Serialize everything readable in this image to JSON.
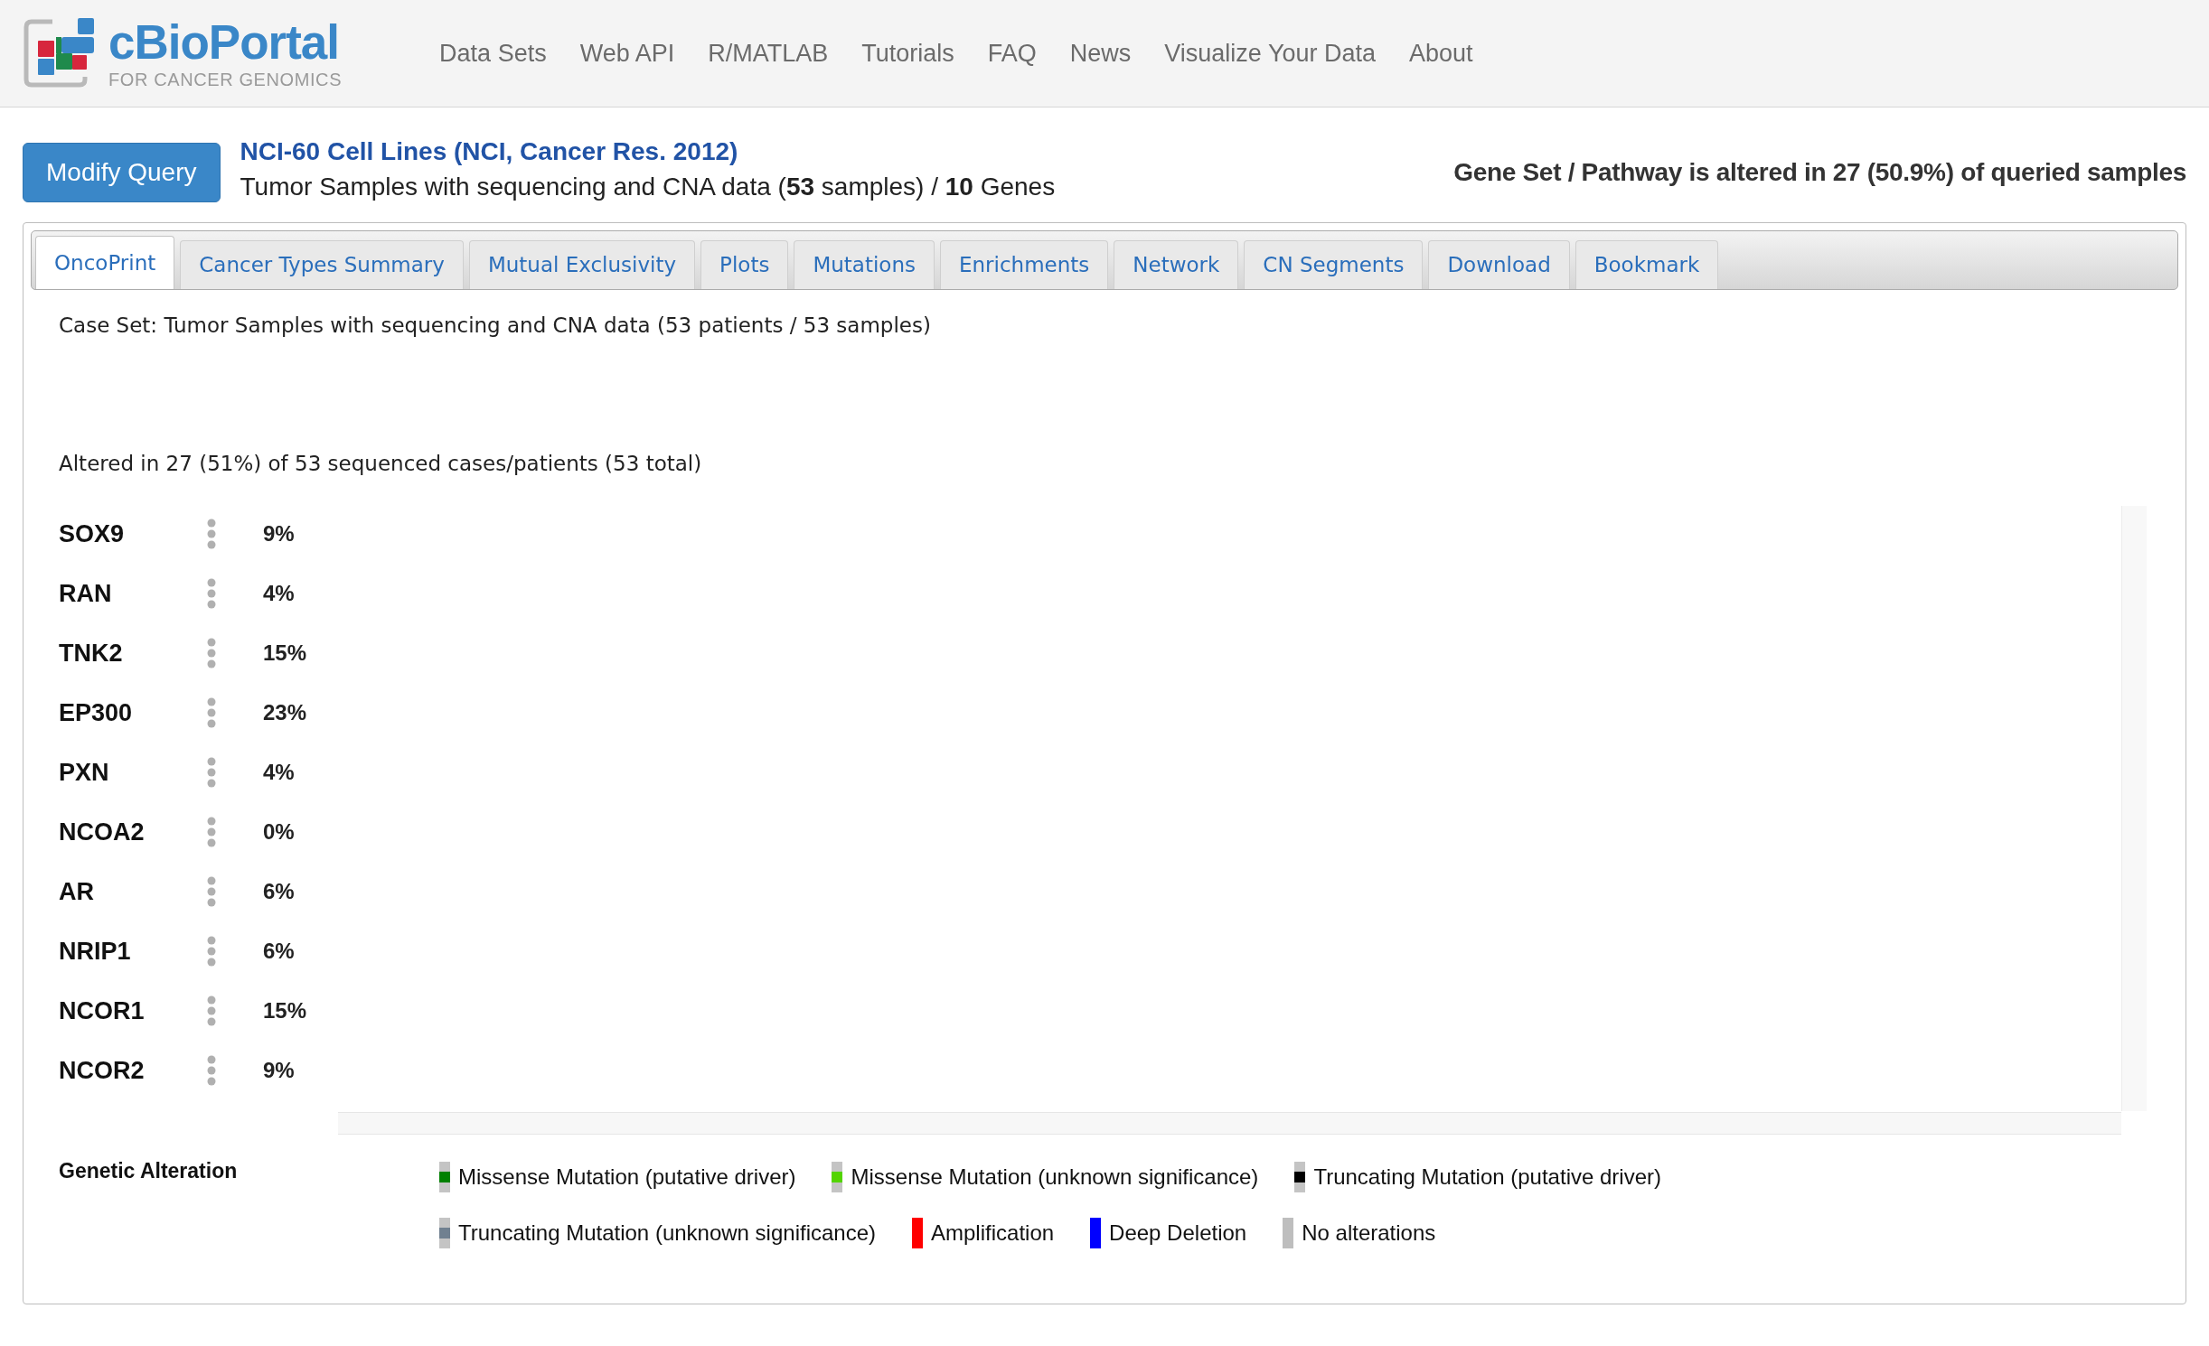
{
  "header": {
    "logo": {
      "title": "cBioPortal",
      "tagline": "FOR CANCER GENOMICS"
    },
    "nav": [
      "Data Sets",
      "Web API",
      "R/MATLAB",
      "Tutorials",
      "FAQ",
      "News",
      "Visualize Your Data",
      "About"
    ]
  },
  "query": {
    "button": "Modify Query",
    "study_title": "NCI-60 Cell Lines (NCI, Cancer Res. 2012)",
    "subtitle": "Tumor Samples with sequencing and CNA data (**53** samples) / **10** Genes",
    "summary": "Gene Set / Pathway is altered in 27 (50.9%) of queried samples"
  },
  "tabs": [
    {
      "label": "OncoPrint",
      "selected": true
    },
    {
      "label": "Cancer Types Summary",
      "selected": false
    },
    {
      "label": "Mutual Exclusivity",
      "selected": false
    },
    {
      "label": "Plots",
      "selected": false
    },
    {
      "label": "Mutations",
      "selected": false
    },
    {
      "label": "Enrichments",
      "selected": false
    },
    {
      "label": "Network",
      "selected": false
    },
    {
      "label": "CN Segments",
      "selected": false
    },
    {
      "label": "Download",
      "selected": false
    },
    {
      "label": "Bookmark",
      "selected": false
    }
  ],
  "oncoprint": {
    "case_set": "Case Set: Tumor Samples with sequencing and CNA data (53 patients / 53 samples)",
    "altered": "Altered in 27 (51%) of 53 sequenced cases/patients (53 total)",
    "genes": [
      {
        "name": "SOX9",
        "percent": "9%"
      },
      {
        "name": "RAN",
        "percent": "4%"
      },
      {
        "name": "TNK2",
        "percent": "15%"
      },
      {
        "name": "EP300",
        "percent": "23%"
      },
      {
        "name": "PXN",
        "percent": "4%"
      },
      {
        "name": "NCOA2",
        "percent": "0%"
      },
      {
        "name": "AR",
        "percent": "6%"
      },
      {
        "name": "NRIP1",
        "percent": "6%"
      },
      {
        "name": "NCOR1",
        "percent": "15%"
      },
      {
        "name": "NCOR2",
        "percent": "9%"
      }
    ],
    "legend": {
      "title": "Genetic Alteration",
      "items": [
        {
          "label": "Missense Mutation (putative driver)",
          "kind": "mutation",
          "color": "#008000"
        },
        {
          "label": "Missense Mutation (unknown significance)",
          "kind": "mutation",
          "color": "#53d400"
        },
        {
          "label": "Truncating Mutation (putative driver)",
          "kind": "mutation",
          "color": "#000000"
        },
        {
          "label": "Truncating Mutation (unknown significance)",
          "kind": "mutation",
          "color": "#708090"
        },
        {
          "label": "Amplification",
          "kind": "full",
          "color": "#ff0000"
        },
        {
          "label": "Deep Deletion",
          "kind": "full",
          "color": "#0000ff"
        },
        {
          "label": "No alterations",
          "kind": "full",
          "color": "#bebebe"
        }
      ]
    }
  }
}
